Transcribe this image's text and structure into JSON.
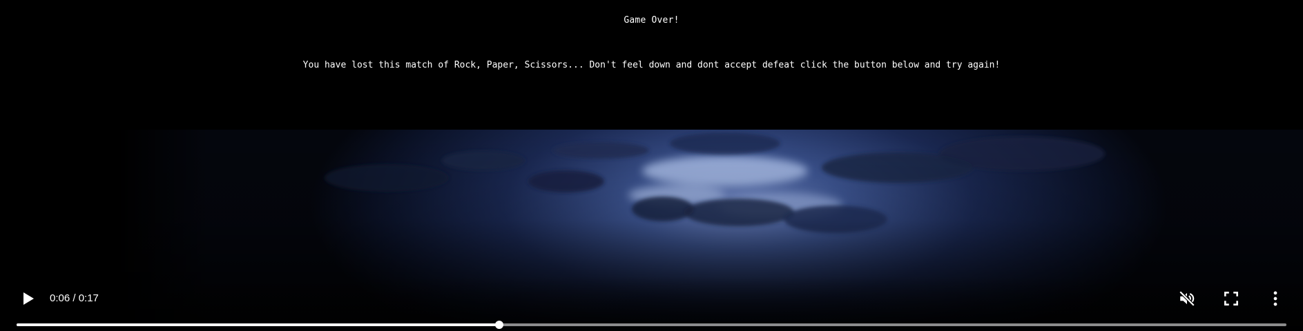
{
  "page": {
    "heading": "Game Over!",
    "message": "You have lost this match of Rock, Paper, Scissors... Don't feel down and dont accept defeat click the button below and try again!"
  },
  "video": {
    "current_time": "0:06",
    "duration": "0:17",
    "time_display": "0:06 / 0:17",
    "progress_fraction": 0.38,
    "muted": true,
    "state": "paused",
    "icons": {
      "play": "play-icon",
      "mute": "volume-muted-icon",
      "fullscreen": "fullscreen-icon",
      "more": "more-vert-icon"
    }
  },
  "colors": {
    "background": "#000000",
    "text": "#ffffff",
    "sky_light": "#8ea2d6",
    "sky_dark": "#0c1430"
  }
}
